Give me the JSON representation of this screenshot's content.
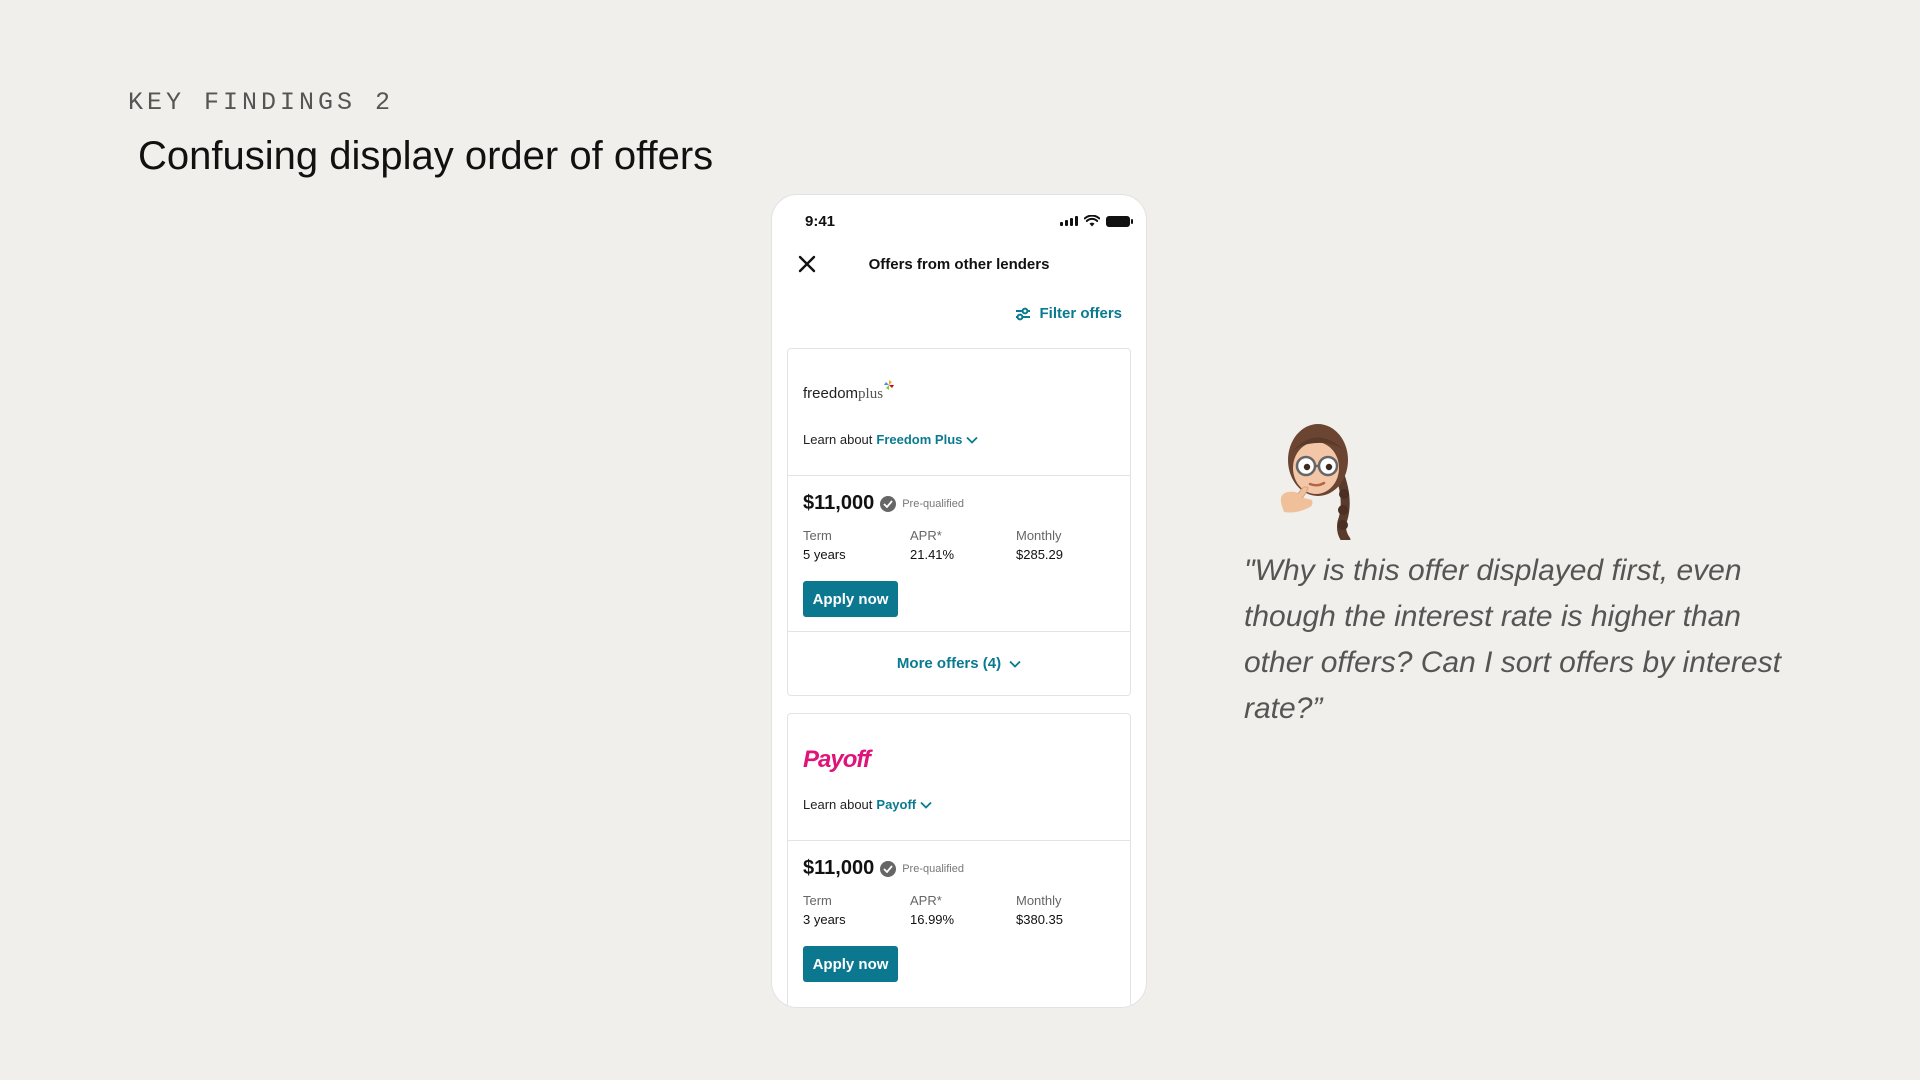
{
  "slide": {
    "eyebrow": "KEY FINDINGS 2",
    "headline": "Confusing display order of offers",
    "quote": "\"Why is this offer displayed first, even though the interest rate is higher than other offers? Can I sort offers by interest rate?”"
  },
  "phone": {
    "time": "9:41",
    "nav_title": "Offers from other lenders",
    "filter_label": "Filter offers",
    "offers": [
      {
        "lender_logo_text_a": "freedom",
        "lender_logo_text_b": "plus",
        "learn_prefix": "Learn about",
        "lender_name": "Freedom Plus",
        "amount": "$11,000",
        "status": "Pre-qualified",
        "term_label": "Term",
        "term_value": "5 years",
        "apr_label": "APR*",
        "apr_value": "21.41%",
        "monthly_label": "Monthly",
        "monthly_value": "$285.29",
        "apply_label": "Apply now",
        "more_label": "More offers (4)"
      },
      {
        "lender_logo_text_a": "Payoff",
        "learn_prefix": "Learn about",
        "lender_name": "Payoff",
        "amount": "$11,000",
        "status": "Pre-qualified",
        "term_label": "Term",
        "term_value": "3 years",
        "apr_label": "APR*",
        "apr_value": "16.99%",
        "monthly_label": "Monthly",
        "monthly_value": "$380.35",
        "apply_label": "Apply now"
      }
    ]
  },
  "colors": {
    "accent": "#0a7a90",
    "button": "#0b7890",
    "payoff_brand": "#e0137a",
    "background": "#f0efeb"
  }
}
